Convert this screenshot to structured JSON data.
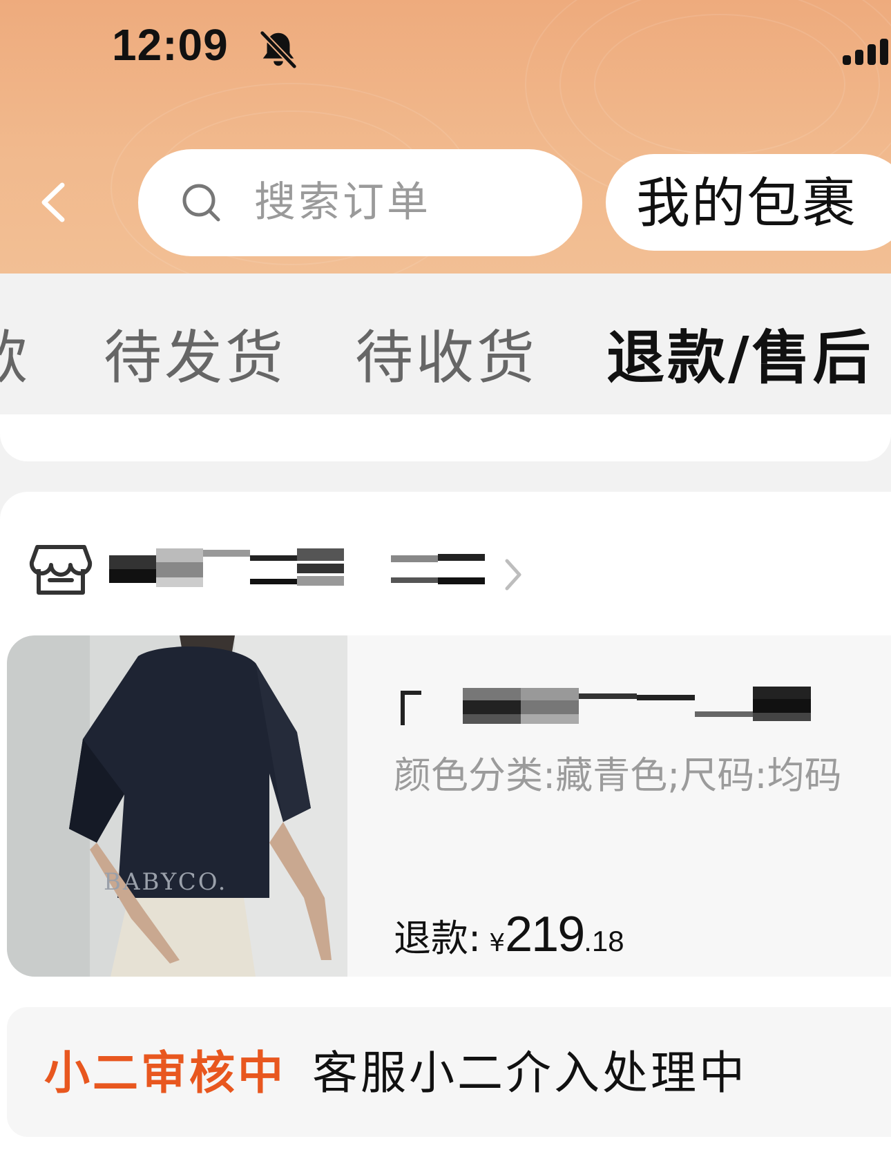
{
  "status_bar": {
    "time": "12:09",
    "mute_icon": "bell-slash-icon",
    "signal_icon": "signal-bars-icon"
  },
  "header": {
    "back_icon": "chevron-left-icon",
    "search": {
      "icon": "search-icon",
      "placeholder": "搜索订单"
    },
    "package_button_label": "我的包裹"
  },
  "tabs": [
    {
      "label": "款",
      "active": false
    },
    {
      "label": "待发货",
      "active": false
    },
    {
      "label": "待收货",
      "active": false
    },
    {
      "label": "退款/售后",
      "active": true
    }
  ],
  "order": {
    "shop_icon": "store-icon",
    "shop_name": "",
    "shop_chevron_icon": "chevron-right-icon",
    "product": {
      "title": "",
      "spec": "颜色分类:藏青色;尺码:均码",
      "image_watermark": "BABYCO.",
      "refund_label": "退款:",
      "currency": "¥",
      "amount_int": "219",
      "amount_dec": ".18"
    },
    "status": {
      "badge": "小二审核中",
      "description": "客服小二介入处理中"
    }
  },
  "colors": {
    "header_orange": "#f1b98d",
    "status_accent": "#e8571f",
    "text_primary": "#111111",
    "text_secondary": "#9b9b9b",
    "background": "#f2f2f2"
  }
}
